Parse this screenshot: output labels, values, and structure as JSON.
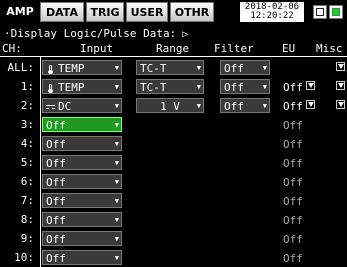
{
  "tabs": {
    "amp": "AMP",
    "data": "DATA",
    "trig": "TRIG",
    "user": "USER",
    "othr": "OTHR"
  },
  "datetime": {
    "date": "2018-02-06",
    "time": "12:20:22"
  },
  "subtitle": "·Display Logic/Pulse Data:",
  "subtitle_icon": "play-icon",
  "headers": {
    "ch": "CH:",
    "input": "Input",
    "range": "Range",
    "filter": "Filter",
    "eu": "EU",
    "misc": "Misc"
  },
  "rows": [
    {
      "ch": "ALL:",
      "input": "TEMP",
      "input_icon": "thermocouple-icon",
      "range": "TC-T",
      "filter": "Off",
      "eu": ""
    },
    {
      "ch": "1:",
      "input": "TEMP",
      "input_icon": "thermocouple-icon",
      "range": "TC-T",
      "filter": "Off",
      "eu": "Off"
    },
    {
      "ch": "2:",
      "input": "DC",
      "input_icon": "dc-icon",
      "range": "1 V",
      "filter": "Off",
      "eu": "Off"
    },
    {
      "ch": "3:",
      "input": "Off",
      "eu": "Off"
    },
    {
      "ch": "4:",
      "input": "Off",
      "eu": "Off"
    },
    {
      "ch": "5:",
      "input": "Off",
      "eu": "Off"
    },
    {
      "ch": "6:",
      "input": "Off",
      "eu": "Off"
    },
    {
      "ch": "7:",
      "input": "Off",
      "eu": "Off"
    },
    {
      "ch": "8:",
      "input": "Off",
      "eu": "Off"
    },
    {
      "ch": "9:",
      "input": "Off",
      "eu": "Off"
    },
    {
      "ch": "10:",
      "input": "Off",
      "eu": "Off"
    }
  ],
  "colors": {
    "selected": "#1f9a1f",
    "field": "#3a3a3a",
    "background": "#000000"
  }
}
